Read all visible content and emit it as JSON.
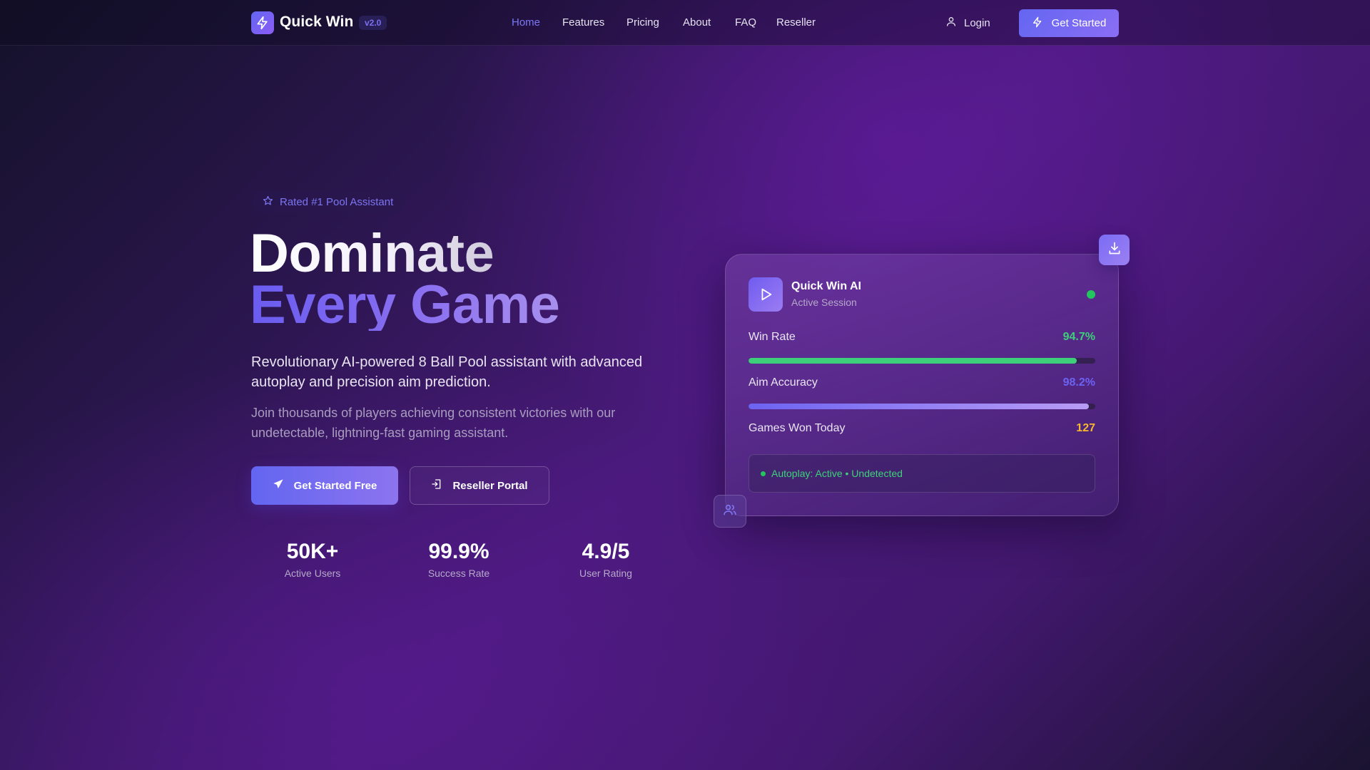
{
  "nav": {
    "logo_text": "Quick Win",
    "version": "v2.0",
    "links": [
      {
        "label": "Home",
        "active": true
      },
      {
        "label": "Features",
        "active": false
      },
      {
        "label": "Pricing",
        "active": false
      },
      {
        "label": "About",
        "active": false
      },
      {
        "label": "FAQ",
        "active": false
      },
      {
        "label": "Reseller",
        "active": false
      }
    ],
    "login_label": "Login",
    "cta_label": "Get Started"
  },
  "hero": {
    "badge": "Rated #1 Pool Assistant",
    "title_line1": "Dominate",
    "title_line2": "Every Game",
    "subtitle": "Revolutionary AI-powered 8 Ball Pool assistant with advanced autoplay and precision aim prediction.",
    "description": "Join thousands of players achieving consistent victories with our undetectable, lightning-fast gaming assistant.",
    "primary_button": "Get Started Free",
    "secondary_button": "Reseller Portal",
    "stats": [
      {
        "value": "50K+",
        "label": "Active Users"
      },
      {
        "value": "99.9%",
        "label": "Success Rate"
      },
      {
        "value": "4.9/5",
        "label": "User Rating"
      }
    ]
  },
  "card": {
    "title": "Quick Win AI",
    "subtitle": "Active Session",
    "status_color": "#22c55e",
    "metrics": [
      {
        "label": "Win Rate",
        "value": "94.7%",
        "progress": 0.947,
        "color": "#3ecf7a"
      },
      {
        "label": "Aim Accuracy",
        "value": "98.2%",
        "progress": 0.982,
        "color": "#6c63f2"
      },
      {
        "label": "Games Won Today",
        "value": "127",
        "color": "#f5b82e"
      }
    ],
    "autoplay_status": "Autoplay: Active • Undetected"
  },
  "icons": {
    "logo": "bolt-icon",
    "login": "user-icon",
    "cta": "bolt-icon",
    "badge": "star-icon",
    "primary_button": "send-icon",
    "secondary_button": "login-icon",
    "card_play": "play-icon",
    "float_download": "download-icon",
    "float_users": "users-icon"
  },
  "colors": {
    "accent": "#6366f1",
    "accent_light": "#8b5cf6",
    "success": "#22c55e",
    "warning": "#f5b82e"
  }
}
